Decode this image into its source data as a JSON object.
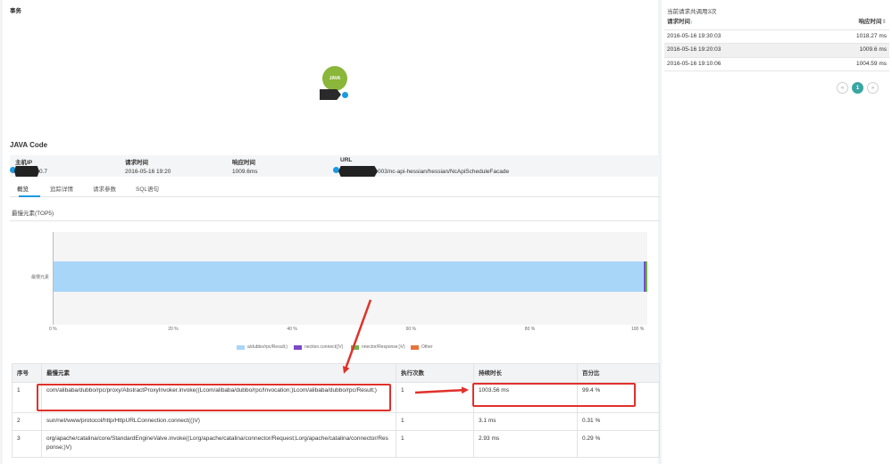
{
  "topology": {
    "title": "事务",
    "node_label": "JAVA"
  },
  "java_code": {
    "title": "JAVA Code",
    "headers": {
      "host_ip": "主机IP",
      "request_time": "请求时间",
      "response_time": "响应时间",
      "url": "URL"
    },
    "values": {
      "host_ip_suffix": "0.7",
      "request_time": "2016-05-16 19:20",
      "response_time": "1009.6ms",
      "url_suffix": "003/nc-api-hessian/hessian/NcApiScheduleFacade"
    }
  },
  "tabs": [
    "概览",
    "追踪详情",
    "请求参数",
    "SQL语句"
  ],
  "chart_data": {
    "type": "bar",
    "title": "最慢元素(TOP5)",
    "orientation": "horizontal",
    "stacked": true,
    "percent": true,
    "categories": [
      "最慢元素"
    ],
    "series": [
      {
        "name": "a/dubbo/rpc/Result;)",
        "values": [
          99.4
        ],
        "color": "#a8d6f8"
      },
      {
        "name": "nection.connect()V)",
        "values": [
          0.31
        ],
        "color": "#7a48c8"
      },
      {
        "name": "nnector/Response;)V)",
        "values": [
          0.29
        ],
        "color": "#6fb44a"
      },
      {
        "name": "Other",
        "values": [
          0
        ],
        "color": "#e8743b"
      }
    ],
    "xlim": [
      0,
      100
    ],
    "x_ticks": [
      "0 %",
      "20 %",
      "40 %",
      "60 %",
      "80 %",
      "100 %"
    ],
    "legend_position": "bottom"
  },
  "table": {
    "headers": [
      "序号",
      "最慢元素",
      "执行次数",
      "持续时长",
      "百分比"
    ],
    "rows": [
      {
        "no": "1",
        "element": "com/alibaba/dubbo/rpc/proxy/AbstractProxyInvoker.invoke((Lcom/alibaba/dubbo/rpc/Invocation;)Lcom/alibaba/dubbo/rpc/Result;)",
        "count": "1",
        "duration": "1003.56 ms",
        "percent": "99.4 %"
      },
      {
        "no": "2",
        "element": "sun/net/www/protocol/http/HttpURLConnection.connect(()V)",
        "count": "1",
        "duration": "3.1 ms",
        "percent": "0.31 %"
      },
      {
        "no": "3",
        "element": "org/apache/catalina/core/StandardEngineValve.invoke((Lorg/apache/catalina/connector/Request;Lorg/apache/catalina/connector/Response;)V)",
        "count": "1",
        "duration": "2.93 ms",
        "percent": "0.29 %"
      }
    ]
  },
  "sidebar": {
    "title": "当前请求共调用3次",
    "headers": {
      "time": "请求时间",
      "time_sort_icon": "↓",
      "response": "响应时间",
      "response_sort_icon": "⇕"
    },
    "rows": [
      {
        "time": "2016-05-16 19:30:03",
        "response": "1018.27 ms"
      },
      {
        "time": "2016-05-16 19:20:03",
        "response": "1009.6 ms"
      },
      {
        "time": "2016-05-16 19:10:06",
        "response": "1004.59 ms"
      }
    ],
    "pager": {
      "prev": "«",
      "current": "1",
      "next": "»"
    }
  }
}
